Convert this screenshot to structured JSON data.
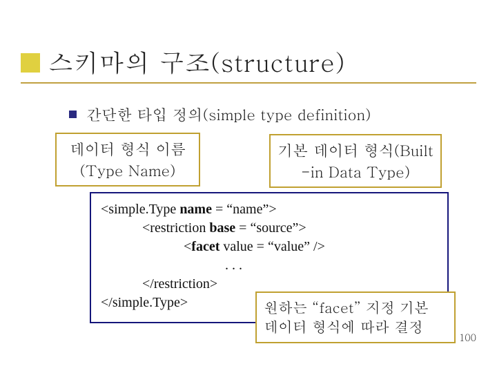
{
  "title": "스키마의 구조(structure)",
  "bullet": "간단한 타입 정의(simple type definition)",
  "box_left": {
    "line1": "데이터 형식 이름",
    "line2": "(Type Name)"
  },
  "box_right": {
    "line1": "기본 데이터 형식(Built",
    "line2": "-in Data Type)"
  },
  "code": {
    "l1_pre": "<simple.Type ",
    "l1_b": "name",
    "l1_post": " = “name”>",
    "l2_pre": "<restriction ",
    "l2_b": "base",
    "l2_post": " = “source”>",
    "l3_pre": "<",
    "l3_b": "facet",
    "l3_post": " value = “value” />",
    "l4": ". . .",
    "l5": "</restriction>",
    "l6": "</simple.Type>"
  },
  "box_bottom": {
    "line1": "원하는 “facet” 지정 기본",
    "line2": "데이터 형식에 따라 결정"
  },
  "page_number": "100"
}
